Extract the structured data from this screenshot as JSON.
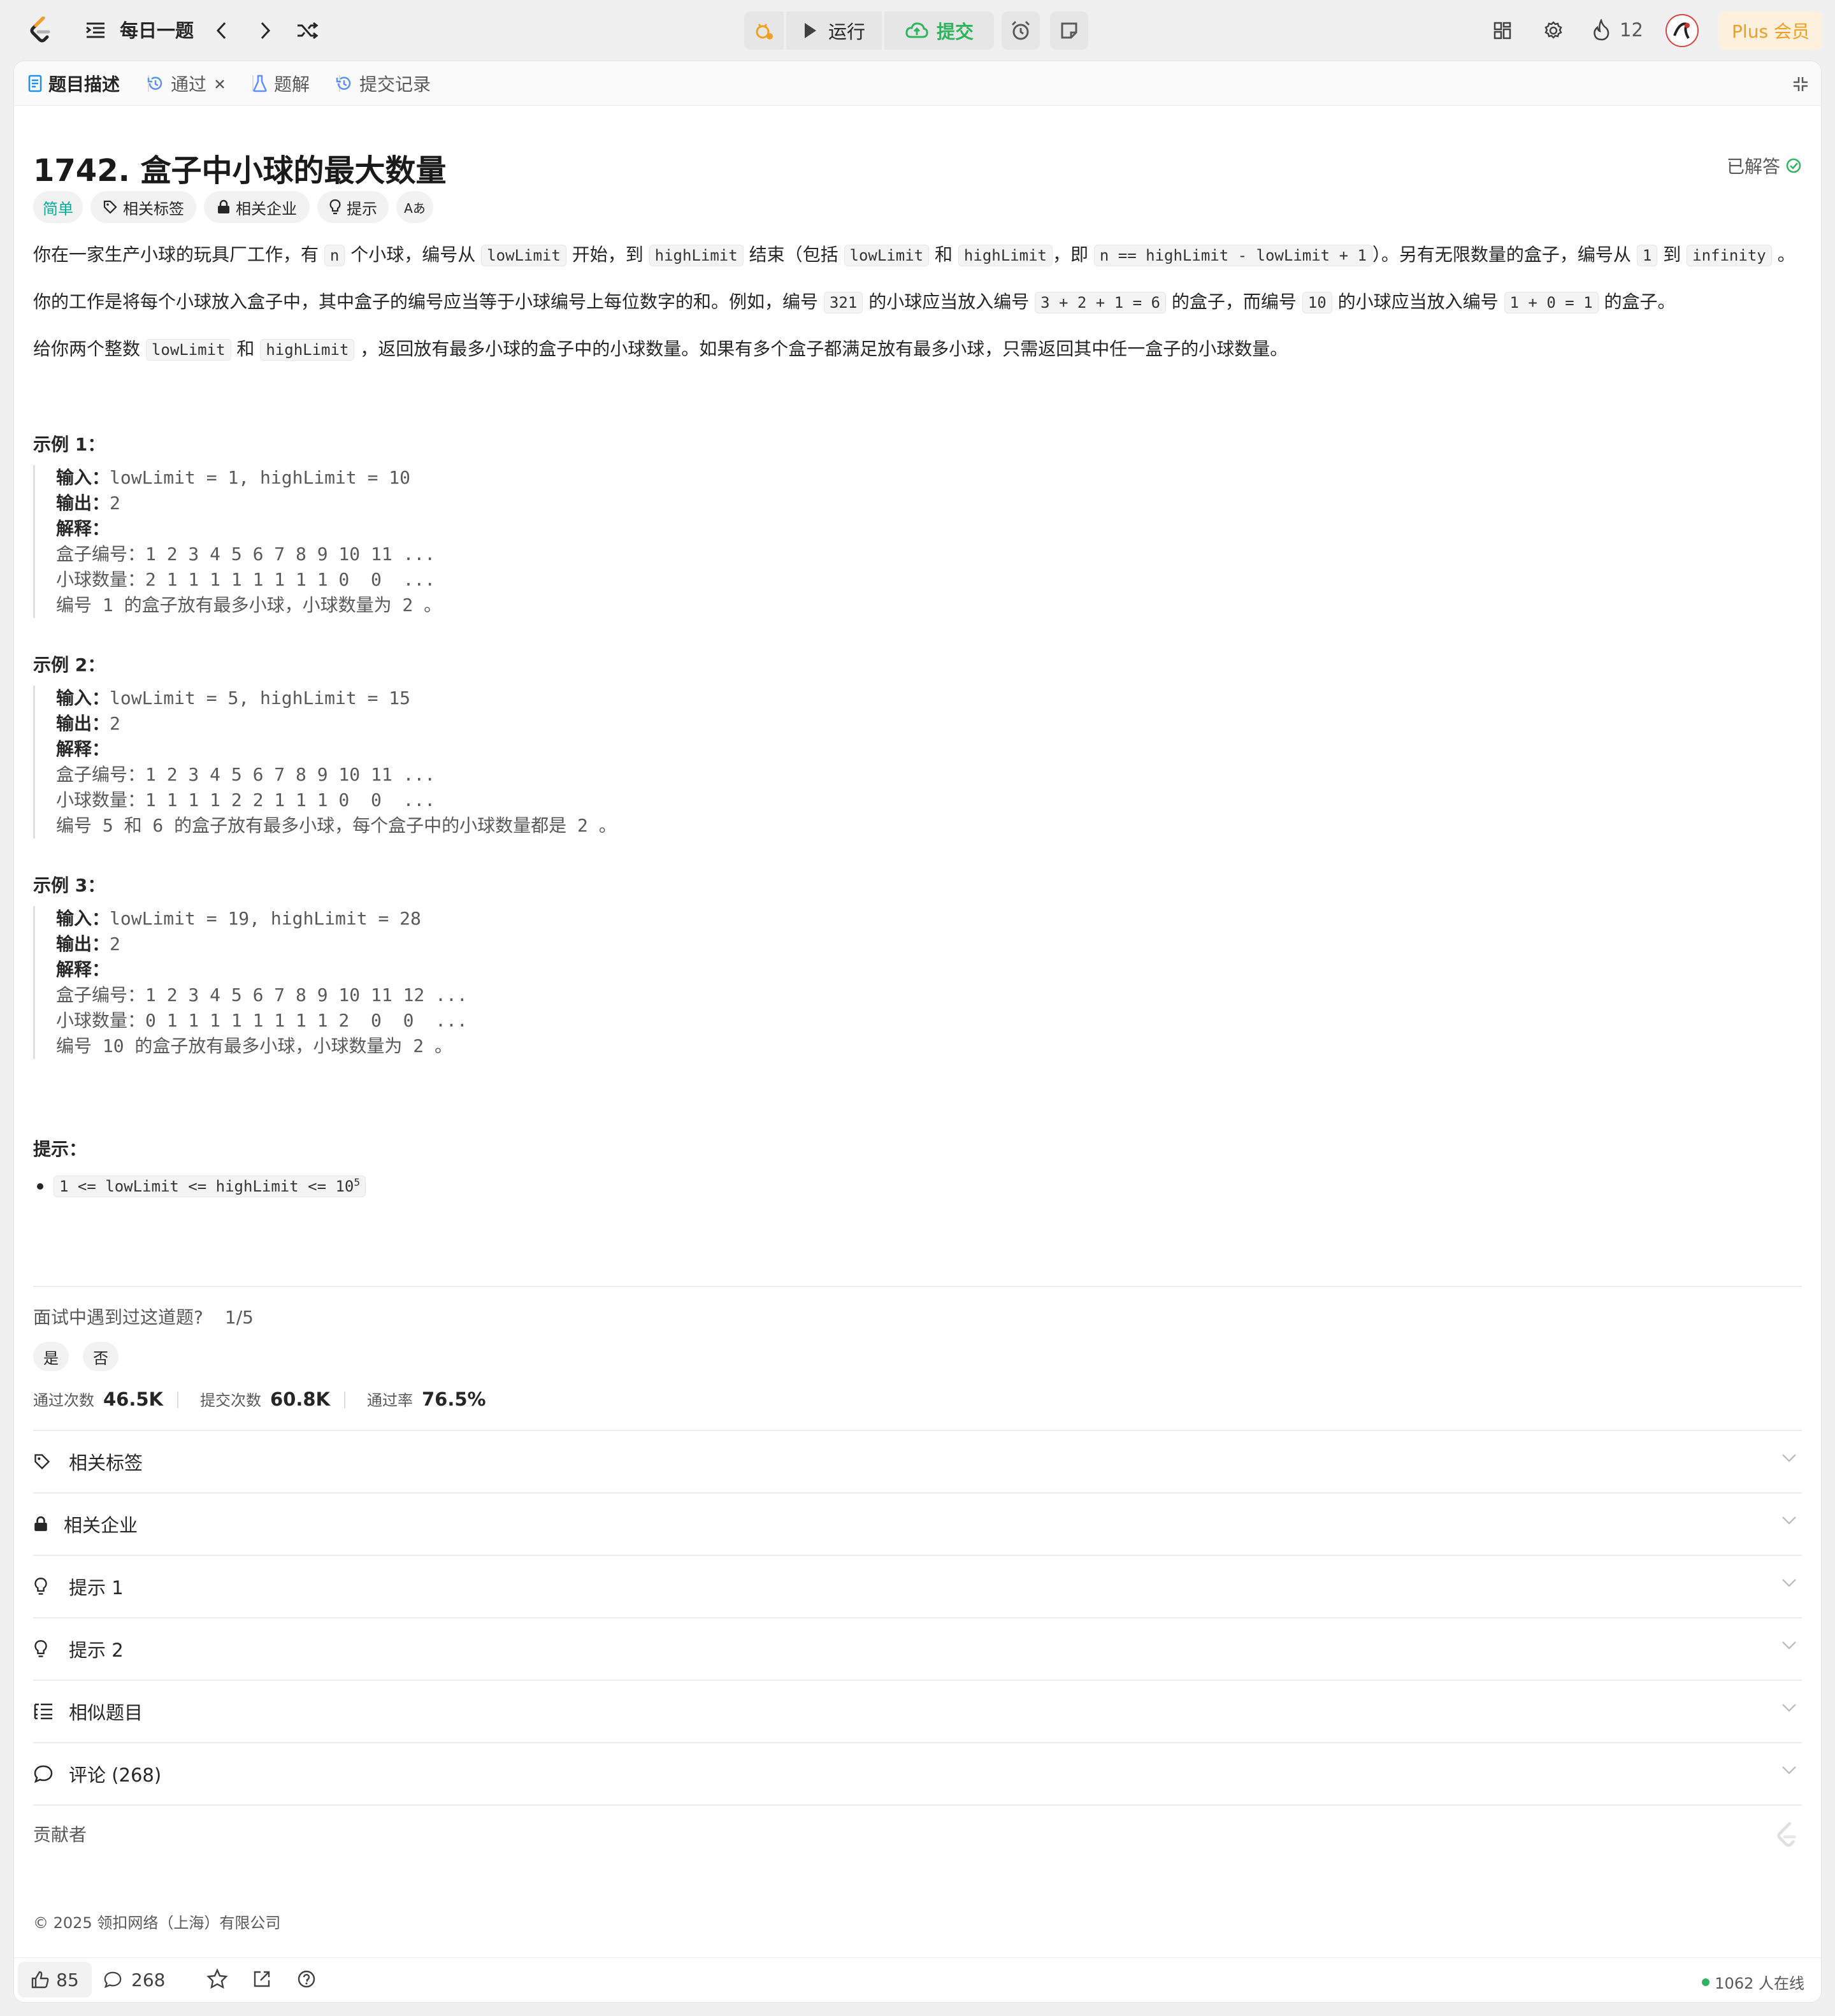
{
  "topbar": {
    "daily_label": "每日一题",
    "run_label": "运行",
    "submit_label": "提交",
    "streak_count": "12",
    "plus_label": "Plus 会员"
  },
  "tabs": [
    {
      "label": "题目描述"
    },
    {
      "label": "通过"
    },
    {
      "label": "题解"
    },
    {
      "label": "提交记录"
    }
  ],
  "problem": {
    "title": "1742. 盒子中小球的最大数量",
    "status": "已解答",
    "difficulty": "简单",
    "chips": [
      "相关标签",
      "相关企业",
      "提示",
      "Aあ"
    ],
    "desc1": {
      "t1": "你在一家生产小球的玩具厂工作，有",
      "c1": "n",
      "t2": "个小球，编号从",
      "c2": "lowLimit",
      "t3": "开始，到",
      "c3": "highLimit",
      "t4": "结束（包括",
      "c4": "lowLimit",
      "t5": "和",
      "c5": "highLimit",
      "t6": "，即",
      "c6": "n == highLimit - lowLimit + 1",
      "t7": "）。另有无限数量的盒子，编号从",
      "c7": "1",
      "t8": "到",
      "c8": "infinity",
      "t9": "。"
    },
    "desc2": {
      "t1": "你的工作是将每个小球放入盒子中，其中盒子的编号应当等于小球编号上每位数字的和。例如，编号",
      "c1": "321",
      "t2": "的小球应当放入编号",
      "c2": "3 + 2 + 1 = 6",
      "t3": "的盒子，而编号",
      "c3": "10",
      "t4": "的小球应当放入编号",
      "c4": "1 + 0 = 1",
      "t5": "的盒子。"
    },
    "desc3": {
      "t1": "给你两个整数",
      "c1": "lowLimit",
      "t2": "和",
      "c2": "highLimit",
      "t3": "，返回放有最多小球的盒子中的小球数量。如果有多个盒子都满足放有最多小球，只需返回其中任一盒子的小球数量。"
    },
    "examples": [
      {
        "title": "示例 1：",
        "input_label": "输入：",
        "input": "lowLimit = 1, highLimit = 10",
        "output_label": "输出：",
        "output": "2",
        "explain_label": "解释：",
        "lines": [
          "盒子编号：1 2 3 4 5 6 7 8 9 10 11 ...",
          "小球数量：2 1 1 1 1 1 1 1 1 0  0  ...",
          "编号 1 的盒子放有最多小球，小球数量为 2 。"
        ]
      },
      {
        "title": "示例 2：",
        "input_label": "输入：",
        "input": "lowLimit = 5, highLimit = 15",
        "output_label": "输出：",
        "output": "2",
        "explain_label": "解释：",
        "lines": [
          "盒子编号：1 2 3 4 5 6 7 8 9 10 11 ...",
          "小球数量：1 1 1 1 2 2 1 1 1 0  0  ...",
          "编号 5 和 6 的盒子放有最多小球，每个盒子中的小球数量都是 2 。"
        ]
      },
      {
        "title": "示例 3：",
        "input_label": "输入：",
        "input": "lowLimit = 19, highLimit = 28",
        "output_label": "输出：",
        "output": "2",
        "explain_label": "解释：",
        "lines": [
          "盒子编号：1 2 3 4 5 6 7 8 9 10 11 12 ...",
          "小球数量：0 1 1 1 1 1 1 1 1 2  0  0  ...",
          "编号 10 的盒子放有最多小球，小球数量为 2 。"
        ]
      }
    ],
    "hints_title": "提示：",
    "constraint_code": "1 <= lowLimit <= highLimit <= 10",
    "constraint_sup": "5"
  },
  "interview": {
    "question": "面试中遇到过这道题?",
    "ratio": "1/5",
    "yes": "是",
    "no": "否"
  },
  "stats": [
    {
      "label": "通过次数",
      "value": "46.5K"
    },
    {
      "label": "提交次数",
      "value": "60.8K"
    },
    {
      "label": "通过率",
      "value": "76.5%"
    }
  ],
  "accordion": [
    {
      "label": "相关标签",
      "icon": "tag-icon"
    },
    {
      "label": "相关企业",
      "icon": "lock-icon"
    },
    {
      "label": "提示 1",
      "icon": "lightbulb-icon"
    },
    {
      "label": "提示 2",
      "icon": "lightbulb-icon"
    },
    {
      "label": "相似题目",
      "icon": "list-tree-icon"
    },
    {
      "label": "评论 (268)",
      "icon": "comment-icon"
    }
  ],
  "contributors_label": "贡献者",
  "copyright": "© 2025 领扣网络（上海）有限公司",
  "footer": {
    "likes": "85",
    "comments": "268",
    "online": "1062 人在线"
  },
  "colors": {
    "accent_green": "#2db55d",
    "easy_teal": "#00af9b",
    "plus_orange": "#f0a020",
    "tab_blue": "#1890ff"
  }
}
